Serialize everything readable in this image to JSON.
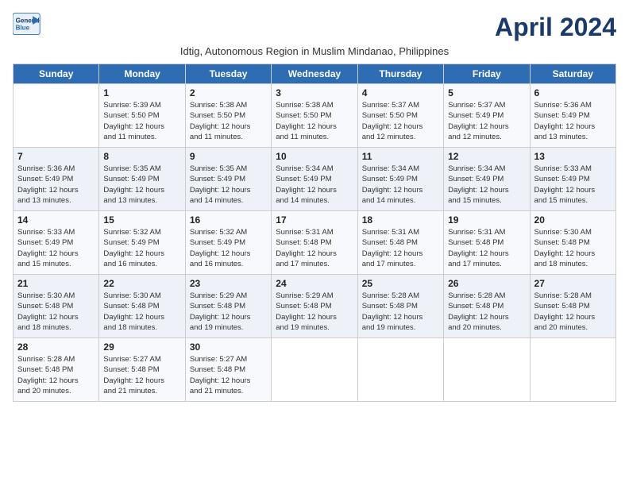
{
  "header": {
    "logo_line1": "General",
    "logo_line2": "Blue",
    "month_title": "April 2024",
    "subtitle": "Idtig, Autonomous Region in Muslim Mindanao, Philippines"
  },
  "weekdays": [
    "Sunday",
    "Monday",
    "Tuesday",
    "Wednesday",
    "Thursday",
    "Friday",
    "Saturday"
  ],
  "weeks": [
    [
      {
        "day": "",
        "info": ""
      },
      {
        "day": "1",
        "info": "Sunrise: 5:39 AM\nSunset: 5:50 PM\nDaylight: 12 hours\nand 11 minutes."
      },
      {
        "day": "2",
        "info": "Sunrise: 5:38 AM\nSunset: 5:50 PM\nDaylight: 12 hours\nand 11 minutes."
      },
      {
        "day": "3",
        "info": "Sunrise: 5:38 AM\nSunset: 5:50 PM\nDaylight: 12 hours\nand 11 minutes."
      },
      {
        "day": "4",
        "info": "Sunrise: 5:37 AM\nSunset: 5:50 PM\nDaylight: 12 hours\nand 12 minutes."
      },
      {
        "day": "5",
        "info": "Sunrise: 5:37 AM\nSunset: 5:49 PM\nDaylight: 12 hours\nand 12 minutes."
      },
      {
        "day": "6",
        "info": "Sunrise: 5:36 AM\nSunset: 5:49 PM\nDaylight: 12 hours\nand 13 minutes."
      }
    ],
    [
      {
        "day": "7",
        "info": "Sunrise: 5:36 AM\nSunset: 5:49 PM\nDaylight: 12 hours\nand 13 minutes."
      },
      {
        "day": "8",
        "info": "Sunrise: 5:35 AM\nSunset: 5:49 PM\nDaylight: 12 hours\nand 13 minutes."
      },
      {
        "day": "9",
        "info": "Sunrise: 5:35 AM\nSunset: 5:49 PM\nDaylight: 12 hours\nand 14 minutes."
      },
      {
        "day": "10",
        "info": "Sunrise: 5:34 AM\nSunset: 5:49 PM\nDaylight: 12 hours\nand 14 minutes."
      },
      {
        "day": "11",
        "info": "Sunrise: 5:34 AM\nSunset: 5:49 PM\nDaylight: 12 hours\nand 14 minutes."
      },
      {
        "day": "12",
        "info": "Sunrise: 5:34 AM\nSunset: 5:49 PM\nDaylight: 12 hours\nand 15 minutes."
      },
      {
        "day": "13",
        "info": "Sunrise: 5:33 AM\nSunset: 5:49 PM\nDaylight: 12 hours\nand 15 minutes."
      }
    ],
    [
      {
        "day": "14",
        "info": "Sunrise: 5:33 AM\nSunset: 5:49 PM\nDaylight: 12 hours\nand 15 minutes."
      },
      {
        "day": "15",
        "info": "Sunrise: 5:32 AM\nSunset: 5:49 PM\nDaylight: 12 hours\nand 16 minutes."
      },
      {
        "day": "16",
        "info": "Sunrise: 5:32 AM\nSunset: 5:49 PM\nDaylight: 12 hours\nand 16 minutes."
      },
      {
        "day": "17",
        "info": "Sunrise: 5:31 AM\nSunset: 5:48 PM\nDaylight: 12 hours\nand 17 minutes."
      },
      {
        "day": "18",
        "info": "Sunrise: 5:31 AM\nSunset: 5:48 PM\nDaylight: 12 hours\nand 17 minutes."
      },
      {
        "day": "19",
        "info": "Sunrise: 5:31 AM\nSunset: 5:48 PM\nDaylight: 12 hours\nand 17 minutes."
      },
      {
        "day": "20",
        "info": "Sunrise: 5:30 AM\nSunset: 5:48 PM\nDaylight: 12 hours\nand 18 minutes."
      }
    ],
    [
      {
        "day": "21",
        "info": "Sunrise: 5:30 AM\nSunset: 5:48 PM\nDaylight: 12 hours\nand 18 minutes."
      },
      {
        "day": "22",
        "info": "Sunrise: 5:30 AM\nSunset: 5:48 PM\nDaylight: 12 hours\nand 18 minutes."
      },
      {
        "day": "23",
        "info": "Sunrise: 5:29 AM\nSunset: 5:48 PM\nDaylight: 12 hours\nand 19 minutes."
      },
      {
        "day": "24",
        "info": "Sunrise: 5:29 AM\nSunset: 5:48 PM\nDaylight: 12 hours\nand 19 minutes."
      },
      {
        "day": "25",
        "info": "Sunrise: 5:28 AM\nSunset: 5:48 PM\nDaylight: 12 hours\nand 19 minutes."
      },
      {
        "day": "26",
        "info": "Sunrise: 5:28 AM\nSunset: 5:48 PM\nDaylight: 12 hours\nand 20 minutes."
      },
      {
        "day": "27",
        "info": "Sunrise: 5:28 AM\nSunset: 5:48 PM\nDaylight: 12 hours\nand 20 minutes."
      }
    ],
    [
      {
        "day": "28",
        "info": "Sunrise: 5:28 AM\nSunset: 5:48 PM\nDaylight: 12 hours\nand 20 minutes."
      },
      {
        "day": "29",
        "info": "Sunrise: 5:27 AM\nSunset: 5:48 PM\nDaylight: 12 hours\nand 21 minutes."
      },
      {
        "day": "30",
        "info": "Sunrise: 5:27 AM\nSunset: 5:48 PM\nDaylight: 12 hours\nand 21 minutes."
      },
      {
        "day": "",
        "info": ""
      },
      {
        "day": "",
        "info": ""
      },
      {
        "day": "",
        "info": ""
      },
      {
        "day": "",
        "info": ""
      }
    ]
  ]
}
